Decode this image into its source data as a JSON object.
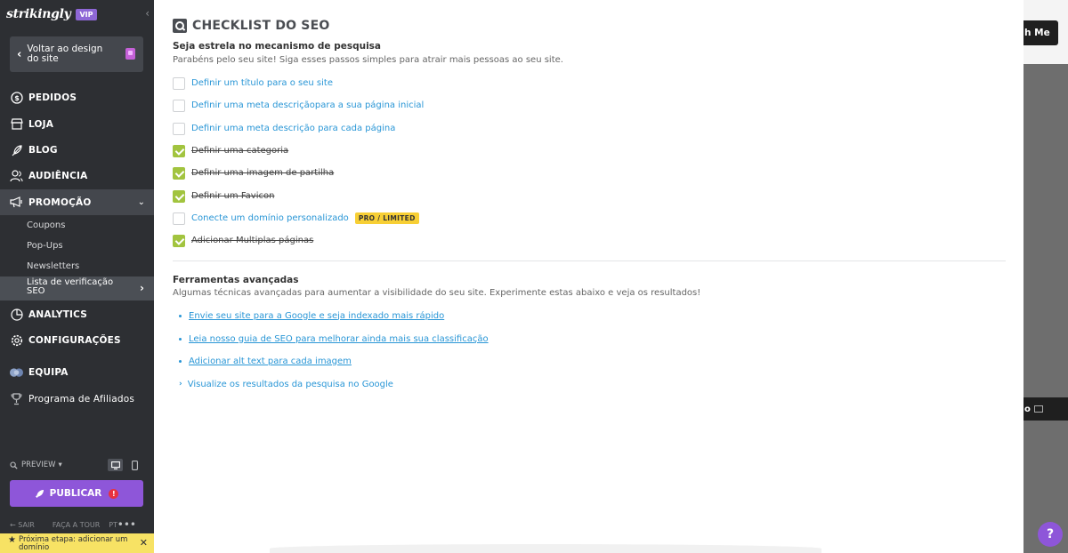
{
  "sidebar": {
    "logo": "strikingly",
    "vip_badge": "VIP",
    "back_button": "Voltar ao design do site",
    "nav": {
      "pedidos": "PEDIDOS",
      "loja": "LOJA",
      "blog": "BLOG",
      "audiencia": "AUDIÊNCIA",
      "promocao": "PROMOÇÃO",
      "analytics": "ANALYTICS",
      "configuracoes": "CONFIGURAÇÕES",
      "equipa": "EQUIPA",
      "afiliados": "Programa de Afiliados"
    },
    "promo_sub": {
      "coupons": "Coupons",
      "popups": "Pop-Ups",
      "newsletters": "Newsletters",
      "seo_checklist": "Lista de verificação SEO"
    },
    "preview_label": "PREVIEW",
    "publish_label": "PUBLICAR",
    "footer": {
      "sair": "SAIR",
      "tour": "FAÇA A TOUR",
      "lang": "PT",
      "more": "•••"
    },
    "next_step": "Próxima etapa: adicionar um domínio"
  },
  "panel": {
    "title": "CHECKLIST DO SEO",
    "section1_heading": "Seja estrela no mecanismo de pesquisa",
    "section1_sub": "Parabéns pelo seu site! Siga esses passos simples para atrair mais pessoas ao seu site.",
    "checklist": [
      {
        "label": "Definir um título para o seu site",
        "done": false
      },
      {
        "label": "Definir uma meta descriçãopara a sua página inicial",
        "done": false
      },
      {
        "label": "Definir uma meta descrição para cada página",
        "done": false
      },
      {
        "label": "Definir uma categoria",
        "done": true
      },
      {
        "label": "Definir uma imagem de partilha",
        "done": true
      },
      {
        "label": "Definir um Favicon",
        "done": true
      },
      {
        "label": "Conecte um domínio personalizado",
        "done": false,
        "badge": "PRO / LIMITED"
      },
      {
        "label": "Adicionar Multiplas páginas",
        "done": true
      }
    ],
    "section2_heading": "Ferramentas avançadas",
    "section2_sub": "Algumas técnicas avançadas para aumentar a visibilidade do seu site. Experimente estas abaixo e veja os resultados!",
    "links": [
      "Envie seu site para a Google e seja indexado mais rápido",
      "Leia nosso guia de SEO para melhorar ainda mais sua classificação",
      "Adicionar alt text para cada imagem"
    ],
    "expand_link": "Visualize os resultados da pesquisa no Google"
  },
  "backdrop": {
    "top_button": "h Me",
    "bar_text": "o"
  },
  "help_label": "?",
  "colors": {
    "sidebar_bg": "#2d2f33",
    "accent_purple": "#8e56d9",
    "link_blue": "#2996d6",
    "check_green": "#a2c43f",
    "badge_yellow": "#f7cf35"
  }
}
